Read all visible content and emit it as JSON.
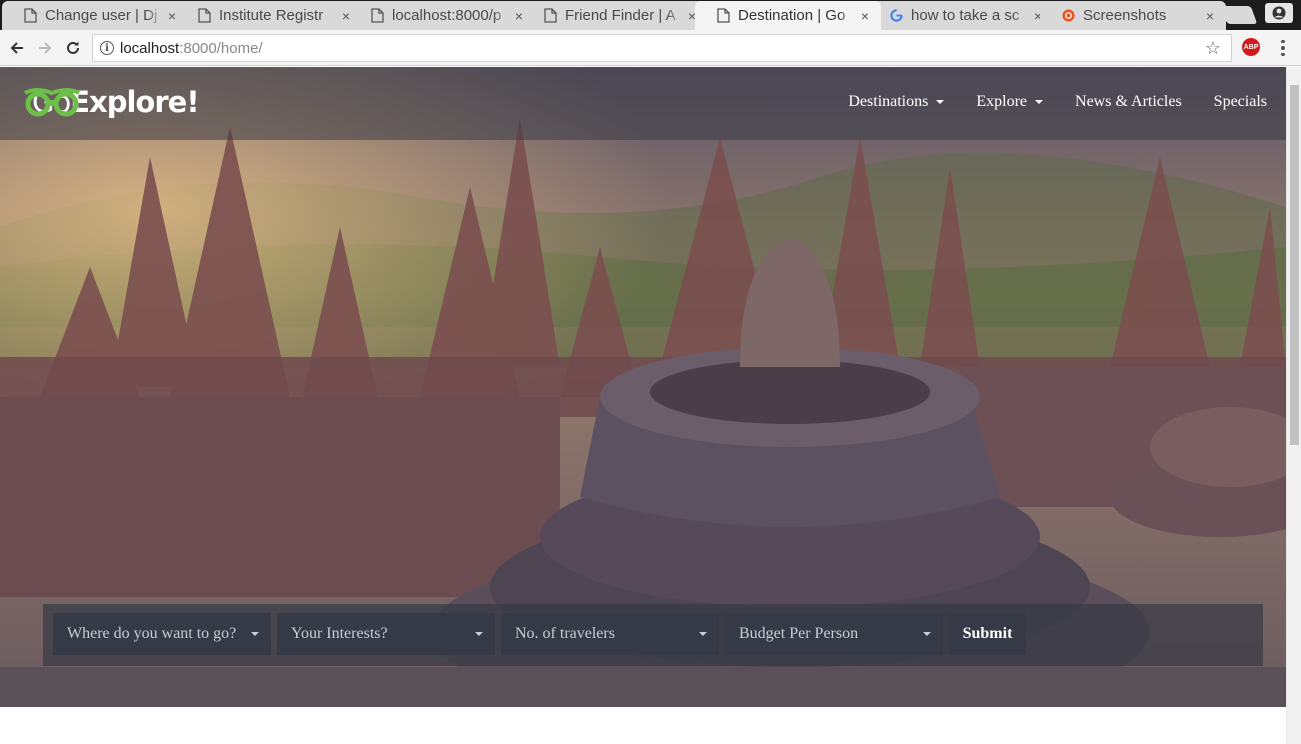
{
  "browser": {
    "tabs": [
      {
        "title": "Change user | Dj",
        "icon": "page-icon",
        "active": false
      },
      {
        "title": "Institute Registr",
        "icon": "page-icon",
        "active": false
      },
      {
        "title": "localhost:8000/p",
        "icon": "page-icon",
        "active": false
      },
      {
        "title": "Friend Finder | A",
        "icon": "page-icon",
        "active": false
      },
      {
        "title": "Destination | Go",
        "icon": "page-icon",
        "active": true
      },
      {
        "title": "how to take a sc",
        "icon": "google-icon",
        "active": false
      },
      {
        "title": "Screenshots",
        "icon": "ubuntu-icon",
        "active": false
      }
    ],
    "close_glyph": "×",
    "url_host": "localhost",
    "url_rest": ":8000/home/",
    "abp_label": "ABP"
  },
  "site": {
    "logo": {
      "light": "Go",
      "bold": "Explore!"
    },
    "nav": [
      {
        "label": "Destinations",
        "dropdown": true
      },
      {
        "label": "Explore",
        "dropdown": true
      },
      {
        "label": "News & Articles",
        "dropdown": false
      },
      {
        "label": "Specials",
        "dropdown": false
      }
    ],
    "search": {
      "destination": "Where do you want to go?",
      "interests": "Your Interests?",
      "travelers": "No. of travelers",
      "budget": "Budget Per Person",
      "submit": "Submit"
    }
  },
  "colors": {
    "logo_green": "#6cc04a",
    "search_field_bg": "#353a46"
  }
}
